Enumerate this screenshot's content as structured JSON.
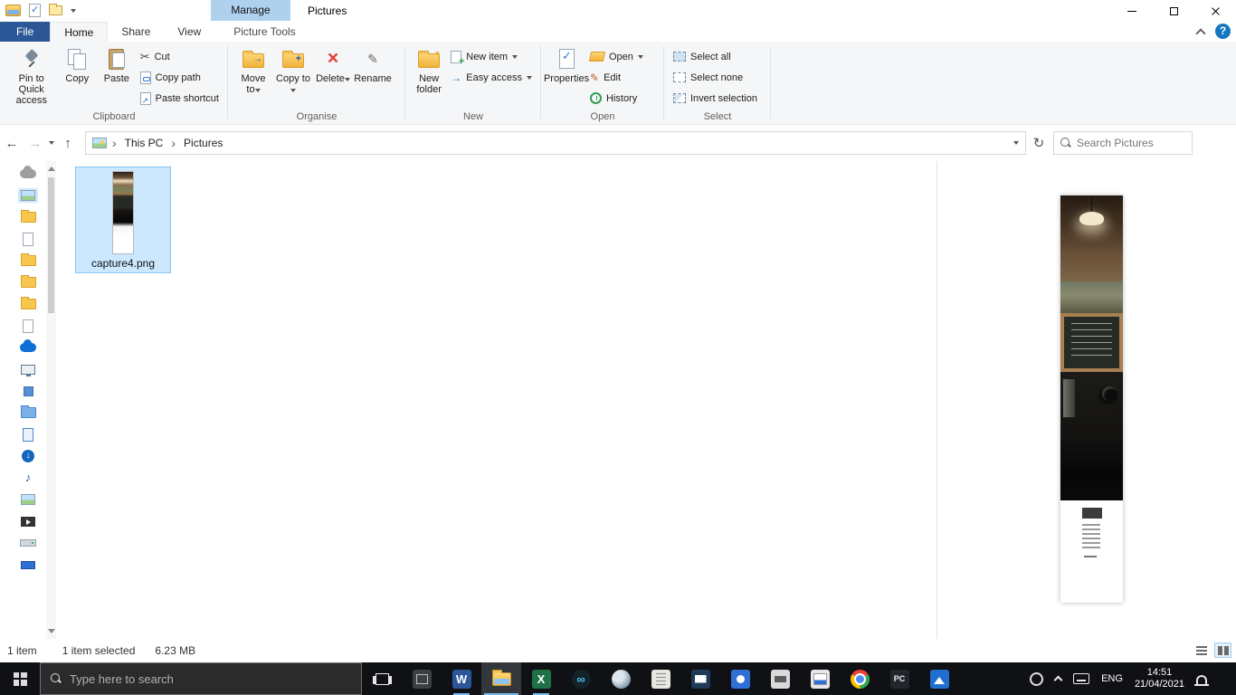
{
  "titlebar": {
    "contextual_header": "Manage",
    "title": "Pictures"
  },
  "ribbon": {
    "file_tab": "File",
    "tabs": [
      {
        "label": "Home"
      },
      {
        "label": "Share"
      },
      {
        "label": "View"
      }
    ],
    "contextual_tab": "Picture Tools",
    "clipboard": {
      "label": "Clipboard",
      "pin": "Pin to Quick access",
      "copy": "Copy",
      "paste": "Paste",
      "cut": "Cut",
      "copy_path": "Copy path",
      "paste_shortcut": "Paste shortcut"
    },
    "organise": {
      "label": "Organise",
      "move_to": "Move to",
      "copy_to": "Copy to",
      "delete": "Delete",
      "rename": "Rename"
    },
    "new": {
      "label": "New",
      "new_folder": "New folder",
      "new_item": "New item",
      "easy_access": "Easy access"
    },
    "open": {
      "label": "Open",
      "properties": "Properties",
      "open": "Open",
      "edit": "Edit",
      "history": "History"
    },
    "select": {
      "label": "Select",
      "select_all": "Select all",
      "select_none": "Select none",
      "invert": "Invert selection"
    }
  },
  "addressbar": {
    "crumb_root": "This PC",
    "crumb_current": "Pictures",
    "search_placeholder": "Search Pictures"
  },
  "content": {
    "file_name": "capture4.png"
  },
  "statusbar": {
    "count": "1 item",
    "selected": "1 item selected",
    "size": "6.23 MB"
  },
  "taskbar": {
    "search_placeholder": "Type here to search",
    "language": "ENG",
    "time": "14:51",
    "date": "21/04/2021"
  },
  "colors": {
    "selection": "#cce8ff",
    "accent": "#2b5797",
    "taskbar": "#101114"
  }
}
